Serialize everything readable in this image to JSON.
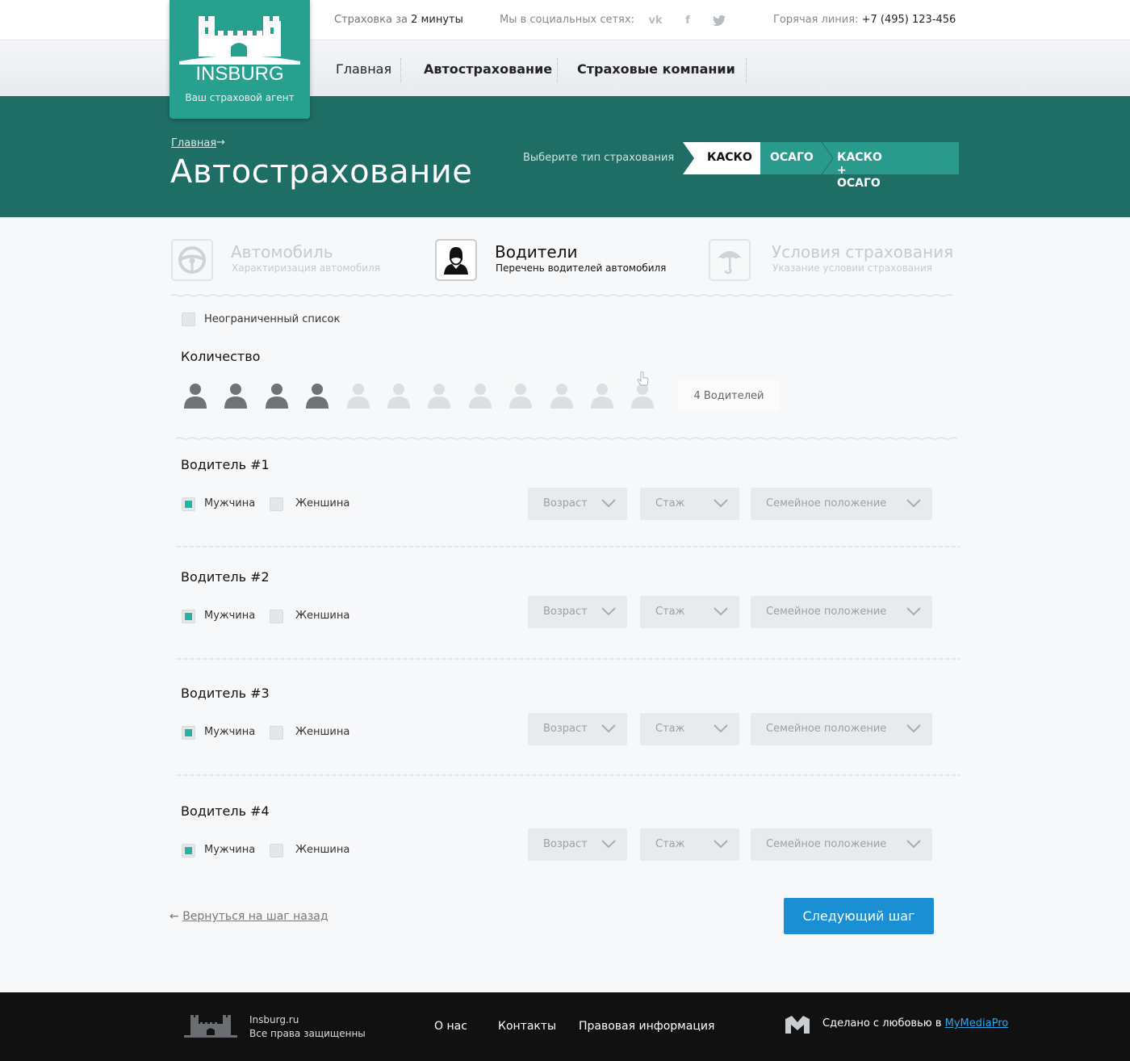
{
  "header": {
    "tagline_prefix": "Страховка за",
    "tagline_strong": "2 минуты",
    "social_label": "Мы в социальных сетях:",
    "social_icons": [
      "vk-icon",
      "facebook-icon",
      "twitter-icon"
    ],
    "hotline_label": "Горячая линия:",
    "hotline_phone": "+7 (495) 123-456"
  },
  "logo": {
    "text": "INSBURG",
    "subtitle": "Ваш страховой агент"
  },
  "nav": {
    "items": [
      {
        "label": "Главная"
      },
      {
        "label": "Автострахование"
      },
      {
        "label": "Страховые компании"
      }
    ]
  },
  "hero": {
    "breadcrumb": "Главная",
    "title": "Автострахование",
    "choose_label": "Выберите тип страхования",
    "types": [
      {
        "label": "КАСКО",
        "selected": true
      },
      {
        "label": "ОСАГО",
        "selected": false
      },
      {
        "label": "КАСКО + ОСАГО",
        "selected": false
      }
    ]
  },
  "steps": [
    {
      "title": "Автомобиль",
      "subtitle": "Характиризация автомобиля",
      "icon": "steering-wheel-icon",
      "active": false
    },
    {
      "title": "Водители",
      "subtitle": "Перечень водителей автомобиля",
      "icon": "driver-icon",
      "active": true
    },
    {
      "title": "Условия страхования",
      "subtitle": "Указание условии страхования",
      "icon": "umbrella-icon",
      "active": false
    }
  ],
  "form": {
    "unlimited_label": "Неограниченный список",
    "unlimited_checked": false,
    "quantity_title": "Количество",
    "quantity_selected": 4,
    "quantity_max": 12,
    "quantity_text": "4 Водителей",
    "drivers": [
      {
        "title": "Водитель #1",
        "male": "Мужчина",
        "female": "Женшина",
        "male_checked": true,
        "age": "Возраст",
        "experience": "Стаж",
        "marital": "Семейное положение"
      },
      {
        "title": "Водитель #2",
        "male": "Мужчина",
        "female": "Женшина",
        "male_checked": true,
        "age": "Возраст",
        "experience": "Стаж",
        "marital": "Семейное положение"
      },
      {
        "title": "Водитель #3",
        "male": "Мужчина",
        "female": "Женшина",
        "male_checked": true,
        "age": "Возраст",
        "experience": "Стаж",
        "marital": "Семейное положение"
      },
      {
        "title": "Водитель #4",
        "male": "Мужчина",
        "female": "Женшина",
        "male_checked": true,
        "age": "Возраст",
        "experience": "Стаж",
        "marital": "Семейное положение"
      }
    ],
    "back_label": "Вернуться на шаг назад",
    "next_label": "Следующий шаг"
  },
  "footer": {
    "site": "Insburg.ru",
    "rights": "Все права защищенны",
    "links": [
      "О нас",
      "Контакты",
      "Правовая информация"
    ],
    "made_with": "Сделано с любовью в",
    "made_by": "MyMediaPro"
  },
  "colors": {
    "teal_dark": "#1f6e66",
    "teal_logo": "#27a08f",
    "teal_tab": "#2a9a8c",
    "checkbox_on": "#26b3a1",
    "button_blue": "#1a8fd4",
    "link_blue": "#2fa4e7"
  }
}
